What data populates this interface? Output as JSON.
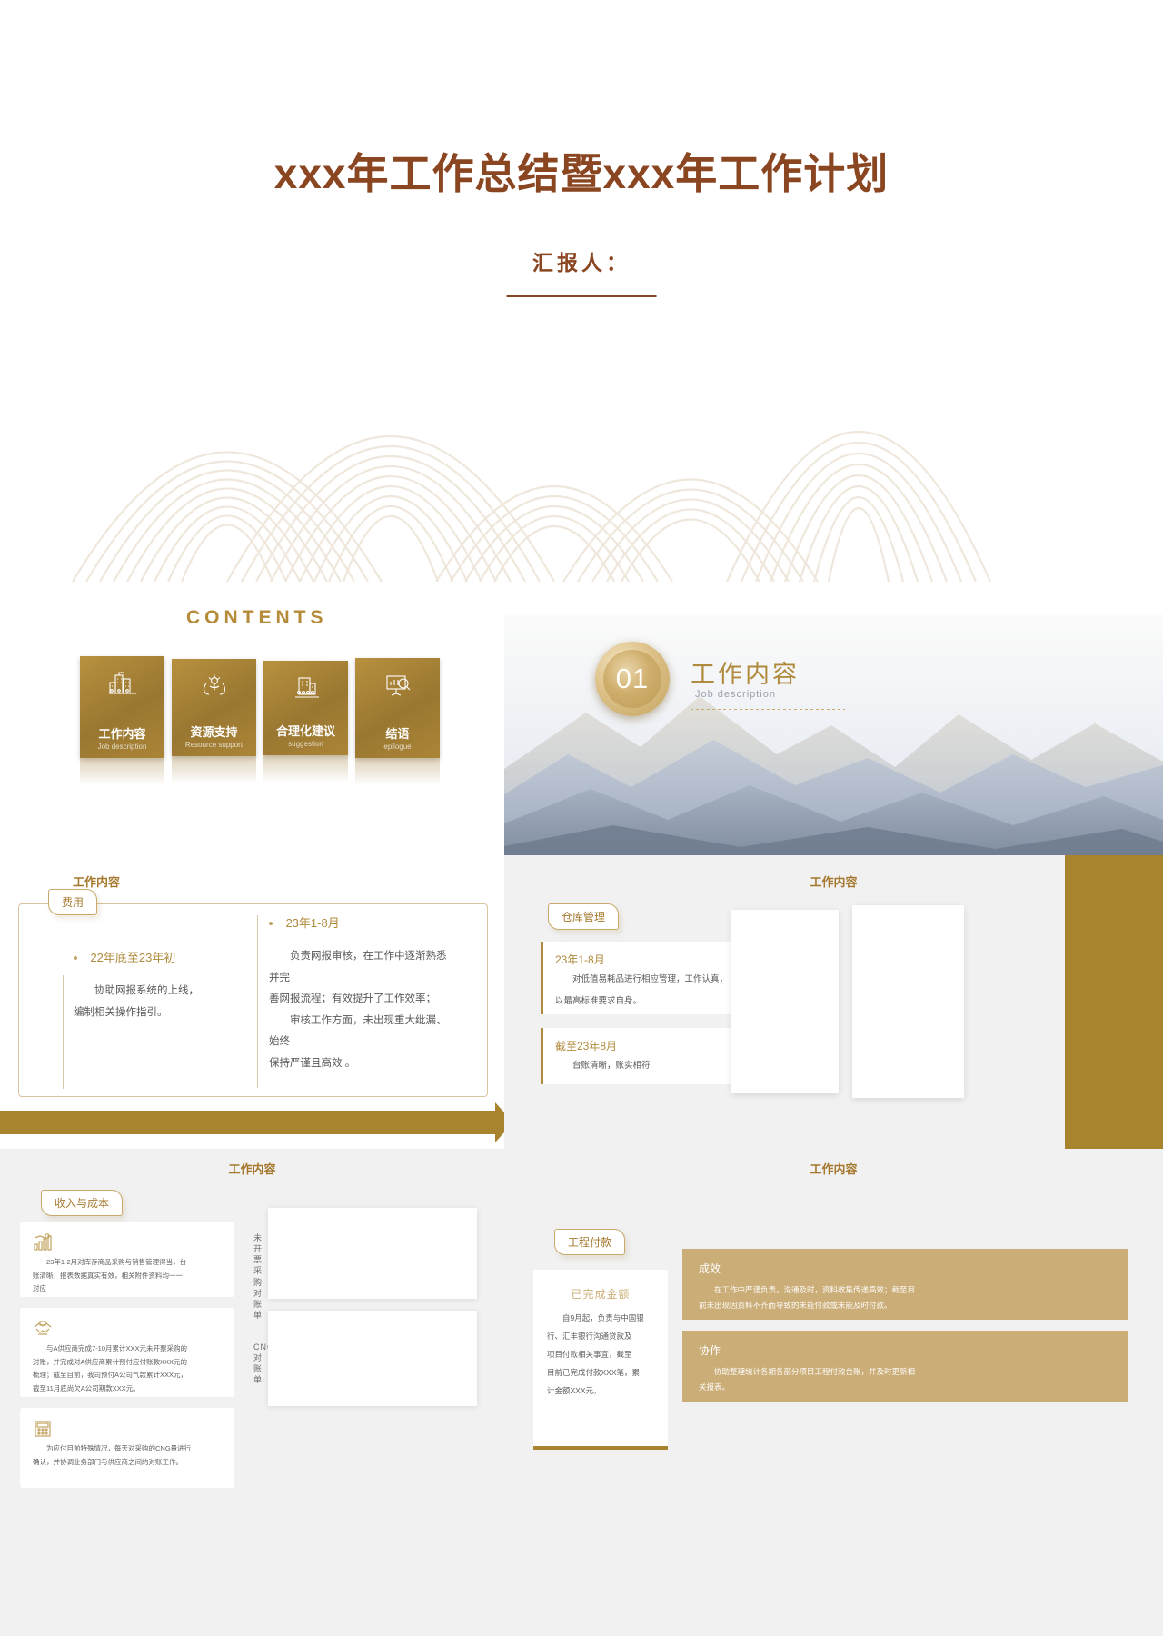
{
  "cover": {
    "title": "xxx年工作总结暨xxx年工作计划",
    "presenter_label": "汇报人：",
    "decoration": "mountain-lines-pattern"
  },
  "contents": {
    "heading": "CONTENTS",
    "cards": [
      {
        "zh": "工作内容",
        "en": "Job description",
        "icon": "city-buildings-icon"
      },
      {
        "zh": "资源支持",
        "en": "Resource support",
        "icon": "hands-plant-icon"
      },
      {
        "zh": "合理化建议",
        "en": "suggestion",
        "icon": "office-people-icon"
      },
      {
        "zh": "结语",
        "en": "epilogue",
        "icon": "chart-board-icon"
      }
    ]
  },
  "section01": {
    "number": "01",
    "zh": "工作内容",
    "en": "Job description"
  },
  "timeline_slide": {
    "header": "工作内容",
    "pill": "费用",
    "left": {
      "date": "22年底至23年初",
      "lines": [
        "协助网报系统的上线，",
        "编制相关操作指引。"
      ]
    },
    "right": {
      "date": "23年1-8月",
      "lines": [
        "负责网报审核，在工作中逐渐熟悉并完",
        "善网报流程；有效提升了工作效率；",
        "审核工作方面，未出现重大纰漏、始终",
        "保持严谨且高效 。"
      ]
    }
  },
  "warehouse_slide": {
    "header": "工作内容",
    "pill": "仓库管理",
    "items": [
      {
        "date": "23年1-8月",
        "lines": [
          "对低值易耗品进行相应管理，工作认真，",
          "以最高标准要求自身。"
        ]
      },
      {
        "date": "截至23年8月",
        "lines": [
          "台账清晰，账实相符"
        ]
      }
    ],
    "placeholders": [
      "image-placeholder-1",
      "image-placeholder-2"
    ]
  },
  "revenue_slide": {
    "header": "工作内容",
    "pill": "收入与成本",
    "cards": [
      {
        "icon": "bar-chart-gold-icon",
        "lines": [
          "23年1-2月对库存商品采购与销售管理得当，台",
          "账清晰，报表数据真实有效，相关附件资料均一一",
          "对应"
        ]
      },
      {
        "icon": "handshake-gold-icon",
        "lines": [
          "与A供应商完成7-10月累计XXX元未开票采购的",
          "对账，并完成对A供应商累计预付应付账款XXX元的",
          "梳理；截至目前，我司预付A公司气款累计XXX元，",
          "截至11月底尚欠A公司期款XXX元。"
        ]
      },
      {
        "icon": "calculator-gold-icon",
        "lines": [
          "为应付目前特殊情况，每天对采购的CNG量进行",
          "确认，并协调业务部门与供应商之间的对账工作。"
        ]
      }
    ],
    "vertical_labels": [
      "未开票采购对账单",
      "CNG对账单"
    ],
    "placeholders": [
      "table-placeholder-1",
      "table-placeholder-2"
    ]
  },
  "payment_slide": {
    "header": "工作内容",
    "pill": "工程付款",
    "amount_card": {
      "title": "已完成金额",
      "lines": [
        "自9月起，负责与中国银",
        "行、汇丰银行沟通贷款及",
        "项目付款相关事宜，截至",
        "目前已完成付款XXX笔，累",
        "计金额XXX元。"
      ]
    },
    "blocks": [
      {
        "title": "成效",
        "lines": [
          "在工作中严谨负责，沟通及时，资料收集传递高效；截至目",
          "前未出现因资料不齐而导致的未能付款或未能及时付款。"
        ]
      },
      {
        "title": "协作",
        "lines": [
          "协助整理统计各期各部分项目工程付款台账，并及时更新相",
          "关报表。"
        ]
      }
    ]
  },
  "colors": {
    "brand_gold": "#a8842f",
    "title_brown": "#8a4521",
    "label_gold": "#b08b3e",
    "panel_gray": "#f1f1f1",
    "block_tan": "#cbad78"
  }
}
